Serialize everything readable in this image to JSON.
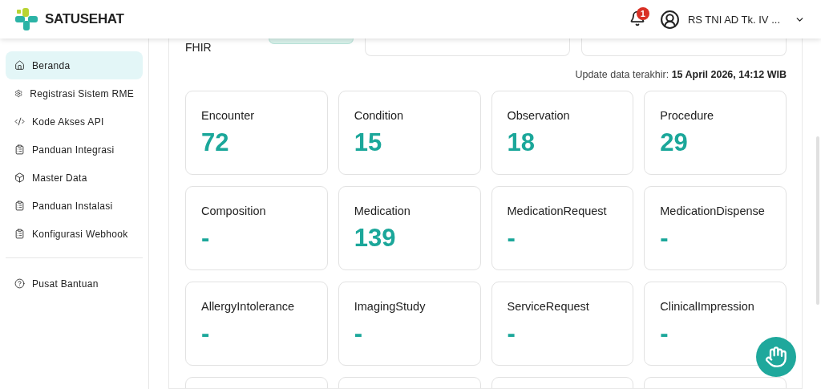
{
  "header": {
    "brand": "SATUSEHAT",
    "notification_count": "1",
    "user_name": "RS TNI AD Tk. IV ..."
  },
  "sidebar": {
    "items": [
      {
        "label": "Beranda",
        "kind": "home",
        "selected": true
      },
      {
        "label": "Registrasi Sistem RME",
        "kind": "gear",
        "selected": false
      },
      {
        "label": "Kode Akses API",
        "kind": "code",
        "selected": false
      },
      {
        "label": "Panduan Integrasi",
        "kind": "guide",
        "selected": false
      },
      {
        "label": "Master Data",
        "kind": "cube",
        "selected": false
      },
      {
        "label": "Panduan Instalasi",
        "kind": "guide",
        "selected": false
      },
      {
        "label": "Konfigurasi Webhook",
        "kind": "guide",
        "selected": false
      }
    ],
    "footer_items": [
      {
        "label": "Pusat Bantuan",
        "kind": "help",
        "selected": false
      }
    ]
  },
  "main": {
    "section_label": "FHIR",
    "update_label": "Update data terakhir:",
    "update_time": "15 April 2026, 14:12 WIB",
    "cards": [
      {
        "label": "Encounter",
        "value": "72"
      },
      {
        "label": "Condition",
        "value": "15"
      },
      {
        "label": "Observation",
        "value": "18"
      },
      {
        "label": "Procedure",
        "value": "29"
      },
      {
        "label": "Composition",
        "value": "-"
      },
      {
        "label": "Medication",
        "value": "139"
      },
      {
        "label": "MedicationRequest",
        "value": "-"
      },
      {
        "label": "MedicationDispense",
        "value": "-"
      },
      {
        "label": "AllergyIntolerance",
        "value": "-"
      },
      {
        "label": "ImagingStudy",
        "value": "-"
      },
      {
        "label": "ServiceRequest",
        "value": "-"
      },
      {
        "label": "ClinicalImpression",
        "value": "-"
      }
    ]
  }
}
